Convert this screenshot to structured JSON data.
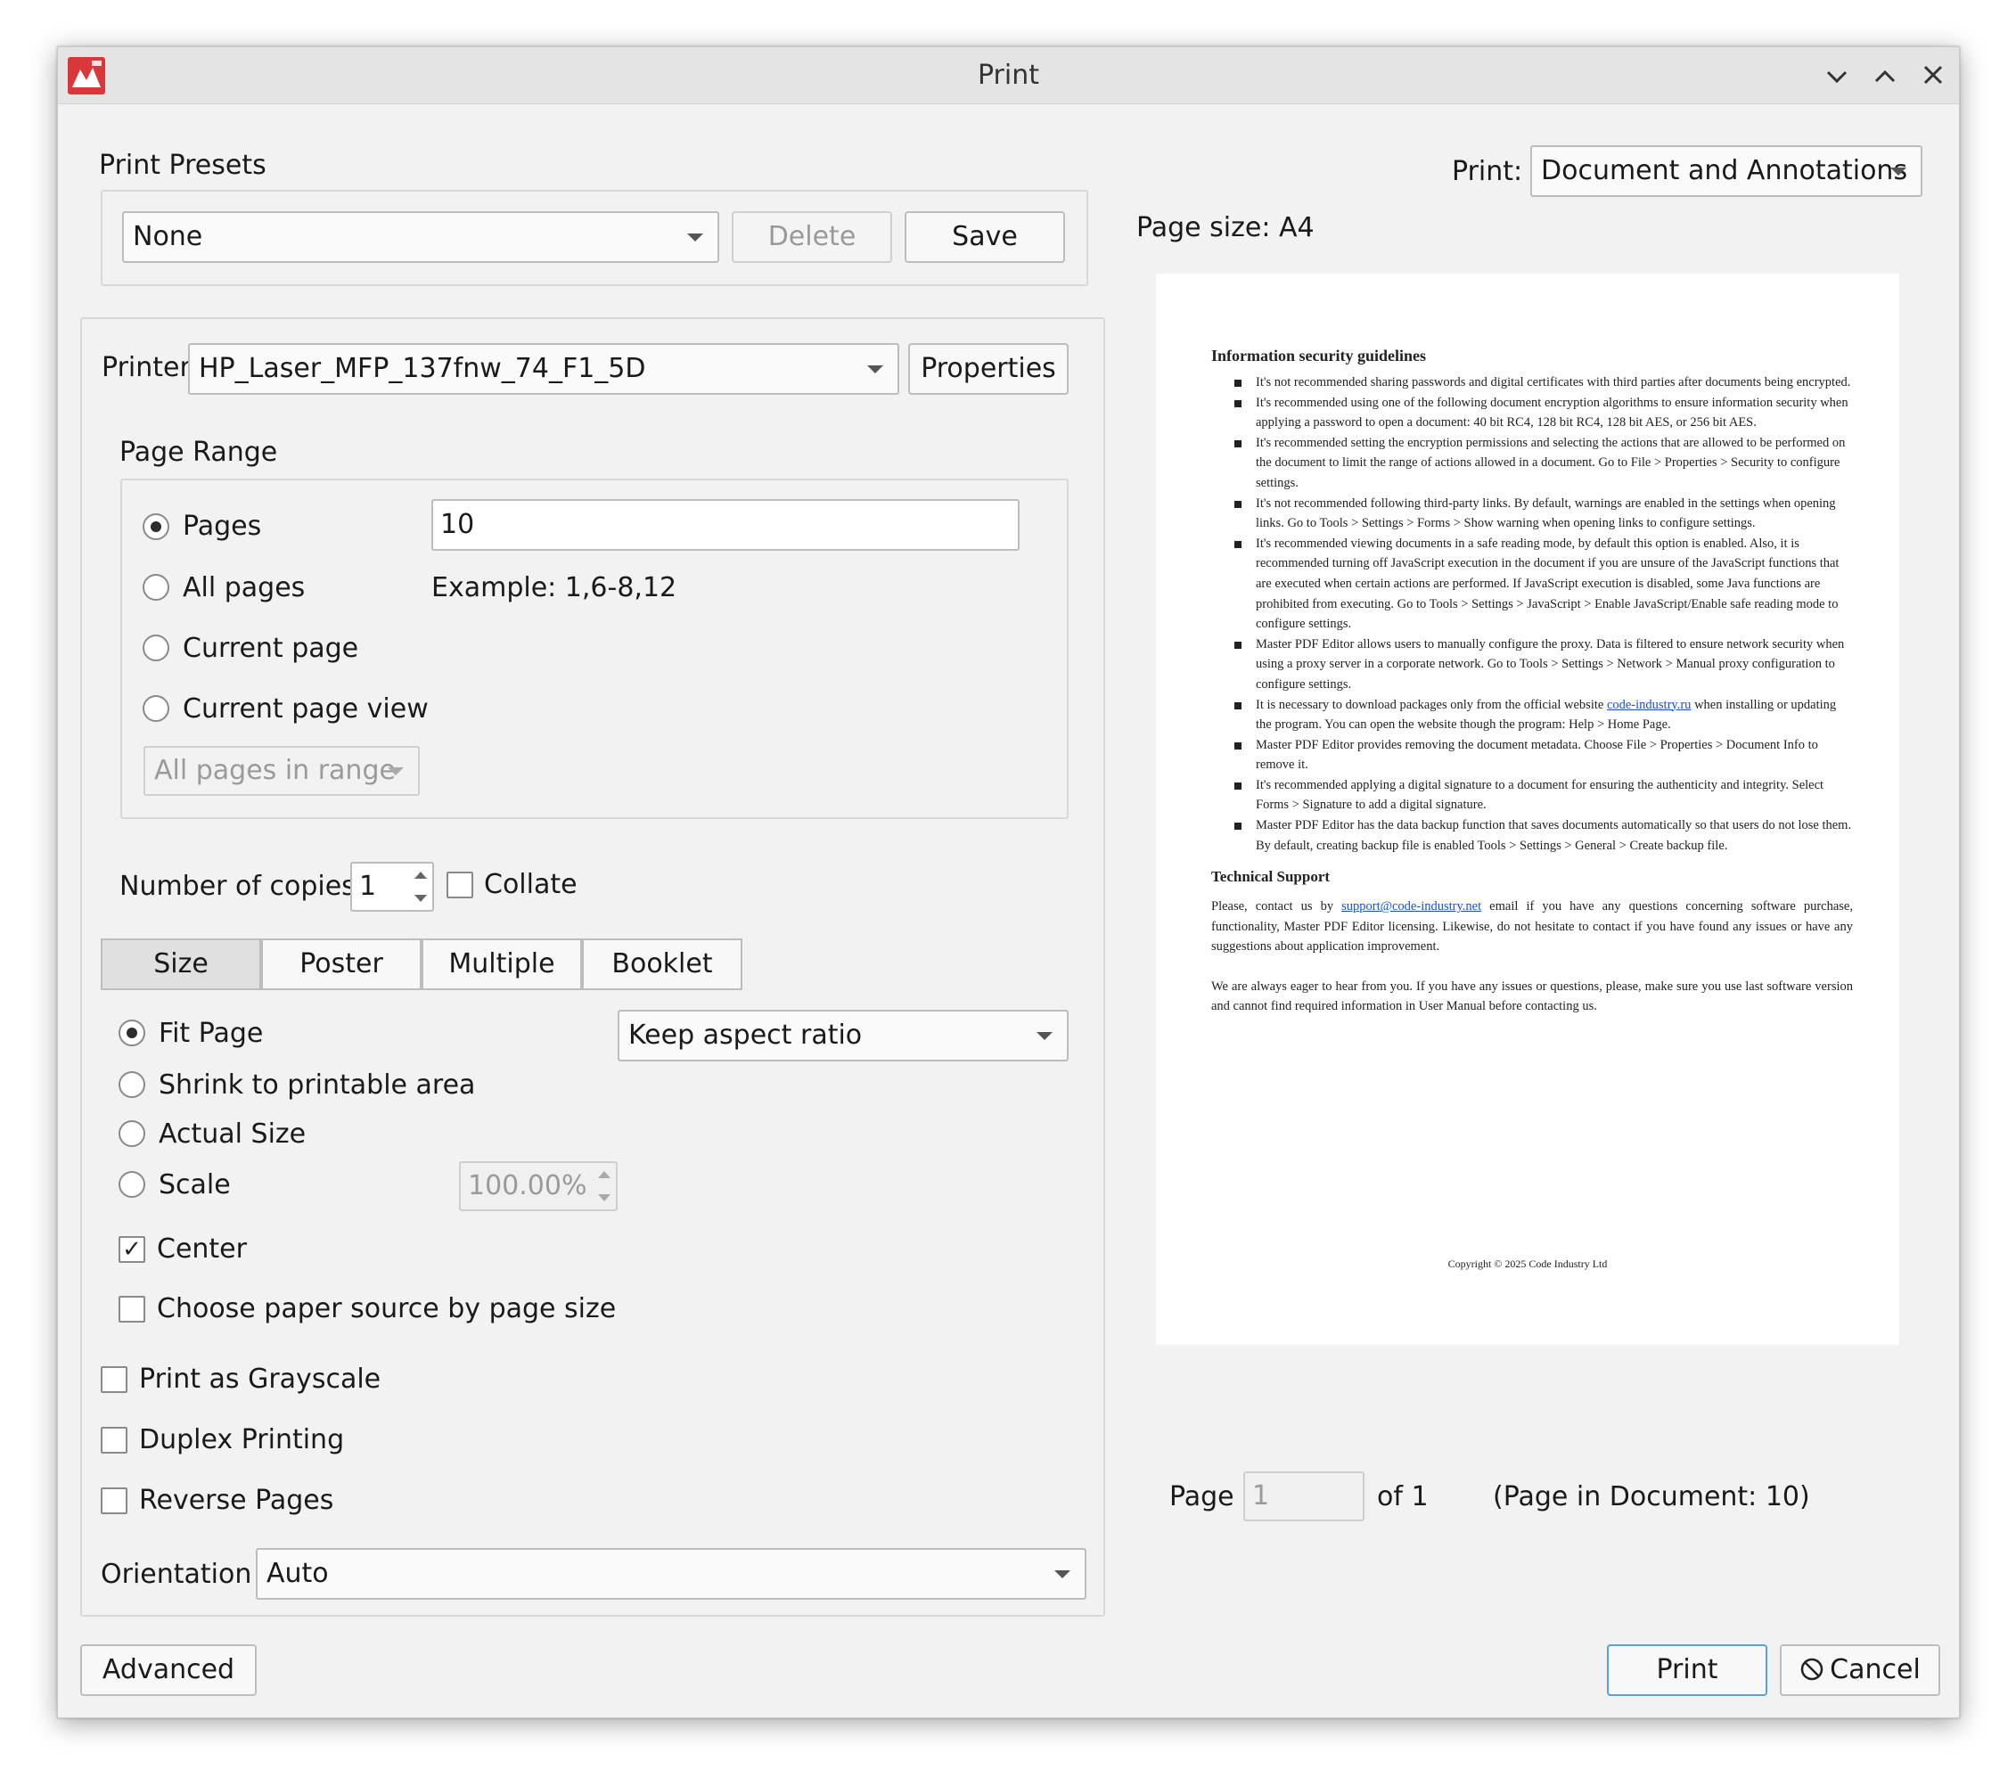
{
  "window": {
    "title": "Print"
  },
  "presets": {
    "label": "Print Presets",
    "value": "None",
    "delete_label": "Delete",
    "save_label": "Save"
  },
  "printer": {
    "label": "Printer",
    "value": "HP_Laser_MFP_137fnw_74_F1_5D",
    "properties_label": "Properties"
  },
  "page_range": {
    "label": "Page Range",
    "pages_label": "Pages",
    "pages_value": "10",
    "all_pages_label": "All pages",
    "example": "Example: 1,6-8,12",
    "current_page_label": "Current page",
    "current_view_label": "Current page view",
    "subset_value": "All pages in range"
  },
  "copies": {
    "label": "Number of copies",
    "value": "1",
    "collate_label": "Collate"
  },
  "tabs": [
    "Size",
    "Poster",
    "Multiple",
    "Booklet"
  ],
  "size": {
    "fit_label": "Fit Page",
    "aspect_value": "Keep aspect ratio",
    "shrink_label": "Shrink to printable area",
    "actual_label": "Actual Size",
    "scale_label": "Scale",
    "scale_value": "100.00%",
    "center_label": "Center",
    "paper_source_label": "Choose paper source by page size"
  },
  "options": {
    "grayscale_label": "Print as Grayscale",
    "duplex_label": "Duplex Printing",
    "reverse_label": "Reverse Pages"
  },
  "orientation": {
    "label": "Orientation",
    "value": "Auto"
  },
  "print_mode": {
    "label": "Print:",
    "value": "Document and Annotations"
  },
  "page_size": "Page size: A4",
  "pager": {
    "page_label": "Page",
    "page_value": "1",
    "of_label": "of 1",
    "doc_page": "(Page in Document: 10)"
  },
  "buttons": {
    "advanced": "Advanced",
    "print": "Print",
    "cancel": "Cancel"
  },
  "colors": {
    "accent": "#5aa0e6",
    "link": "#1a4fd6",
    "logo": "#d9383a"
  },
  "preview": {
    "heading": "Information security guidelines",
    "bullets": [
      "It's not recommended sharing passwords and digital certificates with third parties after documents being encrypted.",
      "It's recommended using one of the following document encryption algorithms to ensure information security when applying a password to open a document: 40 bit RC4, 128 bit RC4, 128 bit AES, or 256 bit AES.",
      "It's recommended setting the encryption permissions and selecting the actions that are allowed to be performed on the document to limit the range of actions allowed in a document. Go to File > Properties > Security to configure settings.",
      "It's not recommended following third-party links. By default, warnings are enabled in the settings when opening links. Go to Tools > Settings > Forms > Show warning when opening links to configure settings.",
      "It's recommended viewing documents in a safe reading mode, by default this option is enabled. Also, it is recommended turning off JavaScript execution in the document if you are unsure of the JavaScript functions that are executed when certain actions are performed. If JavaScript execution is disabled, some Java functions are prohibited from executing. Go to Tools > Settings > JavaScript > Enable JavaScript/Enable safe reading mode to configure settings.",
      "Master PDF Editor allows users to manually configure the proxy. Data is filtered to ensure network security when using a proxy server in a corporate network. Go to Tools > Settings > Network > Manual proxy configuration to configure settings."
    ],
    "bullet7_before": "It is necessary to download packages only from the official website ",
    "bullet7_link": "code-industry.ru",
    "bullet7_after": " when installing or updating the program. You can open the website though the program: Help > Home Page.",
    "bullets_after": [
      "Master PDF Editor provides removing the document metadata. Choose File > Properties > Document Info to remove it.",
      "It's recommended applying a digital signature to a document for ensuring the authenticity and integrity. Select Forms > Signature to add a digital signature.",
      "Master PDF Editor has the data backup function that saves documents automatically so that users do not lose them. By default, creating backup file is enabled Tools > Settings > General > Create backup file."
    ],
    "support_heading": "Technical Support",
    "support_before": "Please, contact us by ",
    "support_link": "support@code-industry.net",
    "support_after": " email if you have any questions concerning software purchase, functionality, Master PDF Editor licensing. Likewise, do not hesitate to contact if you have found any issues or have any suggestions about application improvement.",
    "support_p2": "We are always eager to hear from you. If you have any issues or questions, please, make sure you use last software version and cannot find required information in User Manual before contacting us.",
    "copyright": "Copyright © 2025 Code Industry Ltd"
  }
}
